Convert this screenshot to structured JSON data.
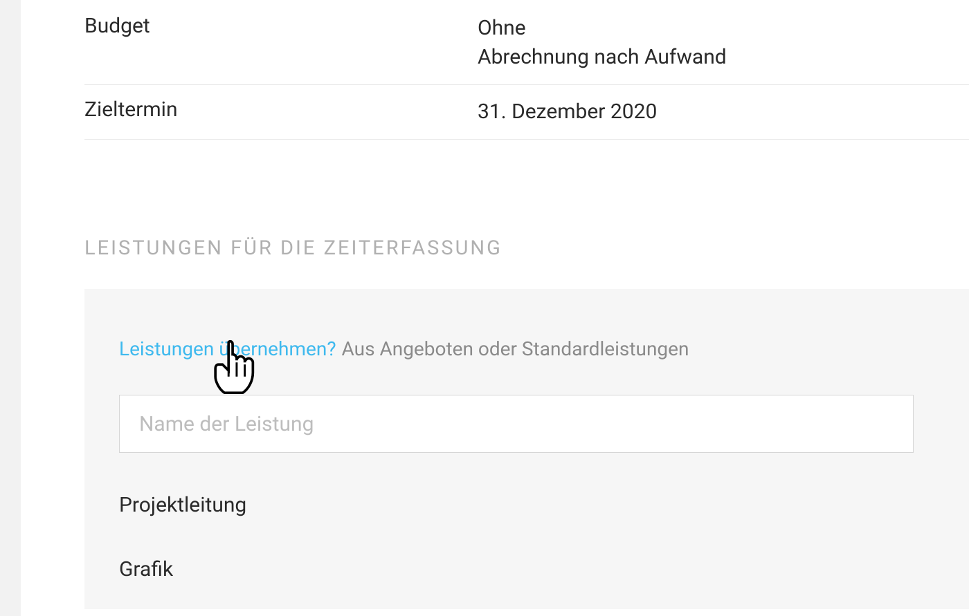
{
  "info": {
    "budget_label": "Budget",
    "budget_value_line1": "Ohne",
    "budget_value_line2": "Abrechnung nach Aufwand",
    "deadline_label": "Zieltermin",
    "deadline_value": "31. Dezember 2020"
  },
  "section": {
    "heading": "LEISTUNGEN FÜR DIE ZEITERFASSUNG"
  },
  "services": {
    "import_link": "Leistungen übernehmen?",
    "import_desc": "Aus Angeboten oder Standardleistungen",
    "input_placeholder": "Name der Leistung",
    "items": [
      "Projektleitung",
      "Grafik"
    ]
  }
}
